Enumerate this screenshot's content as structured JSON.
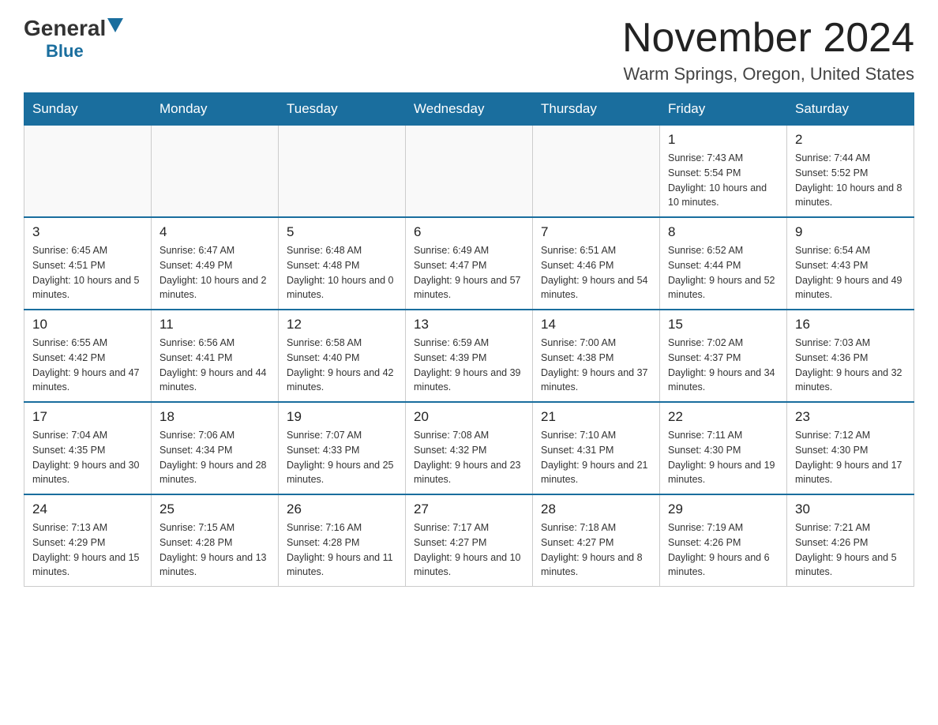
{
  "header": {
    "logo_general": "General",
    "logo_blue": "Blue",
    "month_title": "November 2024",
    "location": "Warm Springs, Oregon, United States"
  },
  "days_of_week": [
    "Sunday",
    "Monday",
    "Tuesday",
    "Wednesday",
    "Thursday",
    "Friday",
    "Saturday"
  ],
  "weeks": [
    {
      "days": [
        {
          "number": "",
          "info": ""
        },
        {
          "number": "",
          "info": ""
        },
        {
          "number": "",
          "info": ""
        },
        {
          "number": "",
          "info": ""
        },
        {
          "number": "",
          "info": ""
        },
        {
          "number": "1",
          "info": "Sunrise: 7:43 AM\nSunset: 5:54 PM\nDaylight: 10 hours\nand 10 minutes."
        },
        {
          "number": "2",
          "info": "Sunrise: 7:44 AM\nSunset: 5:52 PM\nDaylight: 10 hours\nand 8 minutes."
        }
      ]
    },
    {
      "days": [
        {
          "number": "3",
          "info": "Sunrise: 6:45 AM\nSunset: 4:51 PM\nDaylight: 10 hours\nand 5 minutes."
        },
        {
          "number": "4",
          "info": "Sunrise: 6:47 AM\nSunset: 4:49 PM\nDaylight: 10 hours\nand 2 minutes."
        },
        {
          "number": "5",
          "info": "Sunrise: 6:48 AM\nSunset: 4:48 PM\nDaylight: 10 hours\nand 0 minutes."
        },
        {
          "number": "6",
          "info": "Sunrise: 6:49 AM\nSunset: 4:47 PM\nDaylight: 9 hours\nand 57 minutes."
        },
        {
          "number": "7",
          "info": "Sunrise: 6:51 AM\nSunset: 4:46 PM\nDaylight: 9 hours\nand 54 minutes."
        },
        {
          "number": "8",
          "info": "Sunrise: 6:52 AM\nSunset: 4:44 PM\nDaylight: 9 hours\nand 52 minutes."
        },
        {
          "number": "9",
          "info": "Sunrise: 6:54 AM\nSunset: 4:43 PM\nDaylight: 9 hours\nand 49 minutes."
        }
      ]
    },
    {
      "days": [
        {
          "number": "10",
          "info": "Sunrise: 6:55 AM\nSunset: 4:42 PM\nDaylight: 9 hours\nand 47 minutes."
        },
        {
          "number": "11",
          "info": "Sunrise: 6:56 AM\nSunset: 4:41 PM\nDaylight: 9 hours\nand 44 minutes."
        },
        {
          "number": "12",
          "info": "Sunrise: 6:58 AM\nSunset: 4:40 PM\nDaylight: 9 hours\nand 42 minutes."
        },
        {
          "number": "13",
          "info": "Sunrise: 6:59 AM\nSunset: 4:39 PM\nDaylight: 9 hours\nand 39 minutes."
        },
        {
          "number": "14",
          "info": "Sunrise: 7:00 AM\nSunset: 4:38 PM\nDaylight: 9 hours\nand 37 minutes."
        },
        {
          "number": "15",
          "info": "Sunrise: 7:02 AM\nSunset: 4:37 PM\nDaylight: 9 hours\nand 34 minutes."
        },
        {
          "number": "16",
          "info": "Sunrise: 7:03 AM\nSunset: 4:36 PM\nDaylight: 9 hours\nand 32 minutes."
        }
      ]
    },
    {
      "days": [
        {
          "number": "17",
          "info": "Sunrise: 7:04 AM\nSunset: 4:35 PM\nDaylight: 9 hours\nand 30 minutes."
        },
        {
          "number": "18",
          "info": "Sunrise: 7:06 AM\nSunset: 4:34 PM\nDaylight: 9 hours\nand 28 minutes."
        },
        {
          "number": "19",
          "info": "Sunrise: 7:07 AM\nSunset: 4:33 PM\nDaylight: 9 hours\nand 25 minutes."
        },
        {
          "number": "20",
          "info": "Sunrise: 7:08 AM\nSunset: 4:32 PM\nDaylight: 9 hours\nand 23 minutes."
        },
        {
          "number": "21",
          "info": "Sunrise: 7:10 AM\nSunset: 4:31 PM\nDaylight: 9 hours\nand 21 minutes."
        },
        {
          "number": "22",
          "info": "Sunrise: 7:11 AM\nSunset: 4:30 PM\nDaylight: 9 hours\nand 19 minutes."
        },
        {
          "number": "23",
          "info": "Sunrise: 7:12 AM\nSunset: 4:30 PM\nDaylight: 9 hours\nand 17 minutes."
        }
      ]
    },
    {
      "days": [
        {
          "number": "24",
          "info": "Sunrise: 7:13 AM\nSunset: 4:29 PM\nDaylight: 9 hours\nand 15 minutes."
        },
        {
          "number": "25",
          "info": "Sunrise: 7:15 AM\nSunset: 4:28 PM\nDaylight: 9 hours\nand 13 minutes."
        },
        {
          "number": "26",
          "info": "Sunrise: 7:16 AM\nSunset: 4:28 PM\nDaylight: 9 hours\nand 11 minutes."
        },
        {
          "number": "27",
          "info": "Sunrise: 7:17 AM\nSunset: 4:27 PM\nDaylight: 9 hours\nand 10 minutes."
        },
        {
          "number": "28",
          "info": "Sunrise: 7:18 AM\nSunset: 4:27 PM\nDaylight: 9 hours\nand 8 minutes."
        },
        {
          "number": "29",
          "info": "Sunrise: 7:19 AM\nSunset: 4:26 PM\nDaylight: 9 hours\nand 6 minutes."
        },
        {
          "number": "30",
          "info": "Sunrise: 7:21 AM\nSunset: 4:26 PM\nDaylight: 9 hours\nand 5 minutes."
        }
      ]
    }
  ]
}
